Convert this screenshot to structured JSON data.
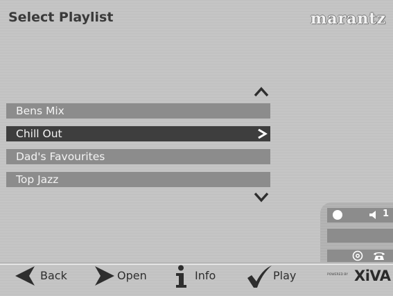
{
  "header": {
    "title": "Select Playlist",
    "brand": "marantz"
  },
  "playlist": {
    "items": [
      {
        "label": "Bens Mix",
        "selected": false
      },
      {
        "label": "Chill Out",
        "selected": true
      },
      {
        "label": "Dad's Favourites",
        "selected": false
      },
      {
        "label": "Top Jazz",
        "selected": false
      }
    ],
    "scroll_up_icon": "chevron-up-icon",
    "scroll_down_icon": "chevron-down-icon",
    "selected_arrow_icon": "chevron-right-icon"
  },
  "status": {
    "volume": "1",
    "icons": [
      "status-led-icon",
      "speaker-icon",
      "disc-icon",
      "phone-icon"
    ]
  },
  "footer": {
    "back_label": "Back",
    "open_label": "Open",
    "info_label": "Info",
    "play_label": "Play",
    "powered_by": "POWERED BY",
    "xiva_logo": "XiVA"
  },
  "colors": {
    "item_bg": "#8c8c8c",
    "item_selected_bg": "#3e3e3e",
    "item_text": "#f4f4f4",
    "title_text": "#3a3a3a"
  }
}
